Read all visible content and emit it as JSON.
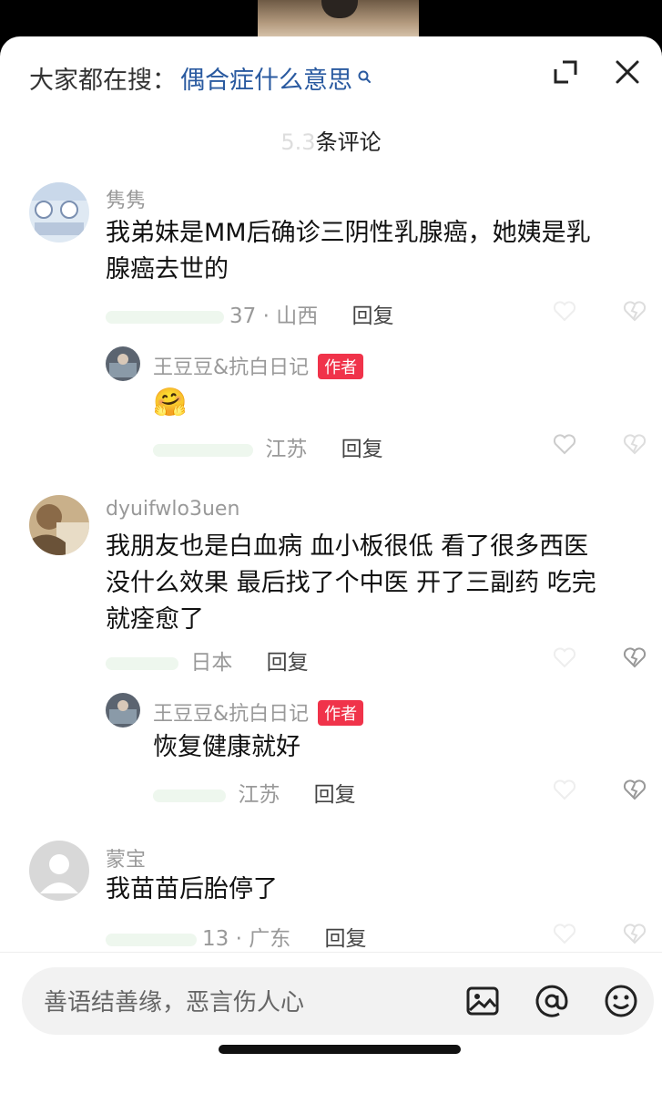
{
  "header": {
    "search_prefix": "大家都在搜：",
    "search_query": "偶合症什么意思",
    "comment_count_hidden": "5.3",
    "comment_count_label": "条评论"
  },
  "comments": [
    {
      "username": "隽隽",
      "text_line1": "我弟妹是MM后确诊三阴性乳腺癌，她姨是乳",
      "text_line2": "腺癌去世的",
      "date_partial": "37 ·",
      "location": "山西",
      "reply_label": "回复",
      "reply": {
        "username": "王豆豆&抗白日记",
        "badge": "作者",
        "text": "🤗",
        "location": "江苏",
        "reply_label": "回复"
      }
    },
    {
      "username": "dyuifwlo3uen",
      "text_line1": "我朋友也是白血病 血小板很低 看了很多西医",
      "text_line2": "没什么效果 最后找了个中医 开了三副药 吃完",
      "text_line3": "就痊愈了",
      "location": "日本",
      "reply_label": "回复",
      "reply": {
        "username": "王豆豆&抗白日记",
        "badge": "作者",
        "text": "恢复健康就好",
        "location": "江苏",
        "reply_label": "回复"
      }
    },
    {
      "username": "蒙宝",
      "text": "我苗苗后胎停了",
      "date_partial": "13 ·",
      "location": "广东",
      "reply_label": "回复"
    }
  ],
  "composer": {
    "placeholder": "善语结善缘，恶言伤人心"
  },
  "colors": {
    "accent_link": "#2a5aa0",
    "badge_red": "#f0334a",
    "muted_text": "#999999"
  }
}
